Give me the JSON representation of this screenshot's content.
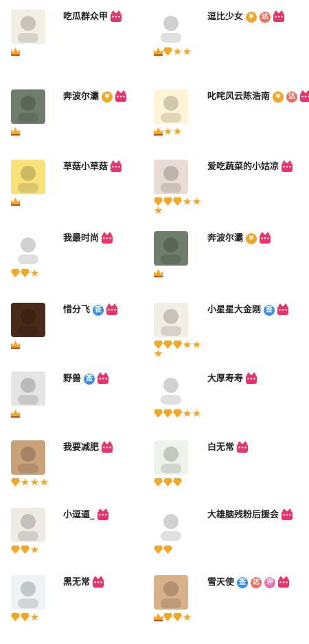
{
  "cat_icon_text": "•••",
  "users": [
    {
      "name": "吃瓜群众甲",
      "badges": [
        "cat"
      ],
      "levels": [
        "crown"
      ],
      "avatar_color": "#f3efe2"
    },
    {
      "name": "逗比少女",
      "badges": [
        "money",
        "da",
        "cat"
      ],
      "levels": [
        "crown",
        "diamond",
        "star",
        "star"
      ],
      "avatar_color": "#ffffff"
    },
    {
      "name": "奔波尔灞",
      "badges": [
        "money",
        "cat"
      ],
      "levels": [
        "crown"
      ],
      "avatar_color": "#6f7d6c"
    },
    {
      "name": "叱咤风云陈浩南",
      "badges": [
        "money",
        "da",
        "cat"
      ],
      "levels": [
        "crown",
        "star",
        "star"
      ],
      "avatar_color": "#fff4d6"
    },
    {
      "name": "草菇小草菇",
      "badges": [
        "cat"
      ],
      "levels": [
        "crown"
      ],
      "avatar_color": "#f9e27a"
    },
    {
      "name": "爱吃蔬菜的小姑凉",
      "badges": [
        "cat"
      ],
      "levels": [
        "diamond",
        "diamond",
        "diamond",
        "star",
        "star",
        "star"
      ],
      "avatar_color": "#e7dcd3"
    },
    {
      "name": "我最时尚",
      "badges": [
        "cat"
      ],
      "levels": [
        "diamond",
        "diamond",
        "star"
      ],
      "avatar_color": "#ffffff"
    },
    {
      "name": "奔波尔灞",
      "badges": [
        "money",
        "cat"
      ],
      "levels": [
        "crown"
      ],
      "avatar_color": "#6f7d6c"
    },
    {
      "name": "惜分飞",
      "badges": [
        "qian",
        "cat"
      ],
      "levels": [
        "crown"
      ],
      "avatar_color": "#4a2a18"
    },
    {
      "name": "小星星大金刚",
      "badges": [
        "qian",
        "cat"
      ],
      "levels": [
        "diamond",
        "diamond",
        "diamond",
        "star",
        "star",
        "star"
      ],
      "avatar_color": "#f3eee4"
    },
    {
      "name": "野兽",
      "badges": [
        "qian",
        "cat"
      ],
      "levels": [
        "crown"
      ],
      "avatar_color": "#e4e4e4"
    },
    {
      "name": "大厚寿寿",
      "badges": [
        "cat"
      ],
      "levels": [
        "diamond",
        "diamond",
        "diamond",
        "star",
        "star"
      ],
      "avatar_color": "#ffffff"
    },
    {
      "name": "我要减肥",
      "badges": [
        "cat"
      ],
      "levels": [
        "diamond",
        "star",
        "star",
        "star"
      ],
      "avatar_color": "#c9a27a"
    },
    {
      "name": "白无常",
      "badges": [
        "cat"
      ],
      "levels": [
        "diamond",
        "diamond",
        "diamond"
      ],
      "avatar_color": "#eef3ea"
    },
    {
      "name": "小逗逼_",
      "badges": [
        "cat"
      ],
      "levels": [
        "diamond",
        "diamond",
        "star"
      ],
      "avatar_color": "#eeeae4"
    },
    {
      "name": "大雄脑残粉后援会",
      "badges": [
        "cat"
      ],
      "levels": [
        "diamond",
        "diamond"
      ],
      "avatar_color": "#ffffff"
    },
    {
      "name": "黑无常",
      "badges": [
        "cat"
      ],
      "levels": [
        "diamond",
        "diamond",
        "star"
      ],
      "avatar_color": "#eef3f4"
    },
    {
      "name": "雪天使",
      "badges": [
        "qian",
        "da",
        "ping",
        "cat"
      ],
      "levels": [
        "crown",
        "diamond",
        "diamond",
        "star"
      ],
      "avatar_color": "#d8b08a"
    }
  ],
  "badge_text": {
    "money": "¥",
    "da": "达",
    "qian": "签",
    "ping": "评"
  }
}
